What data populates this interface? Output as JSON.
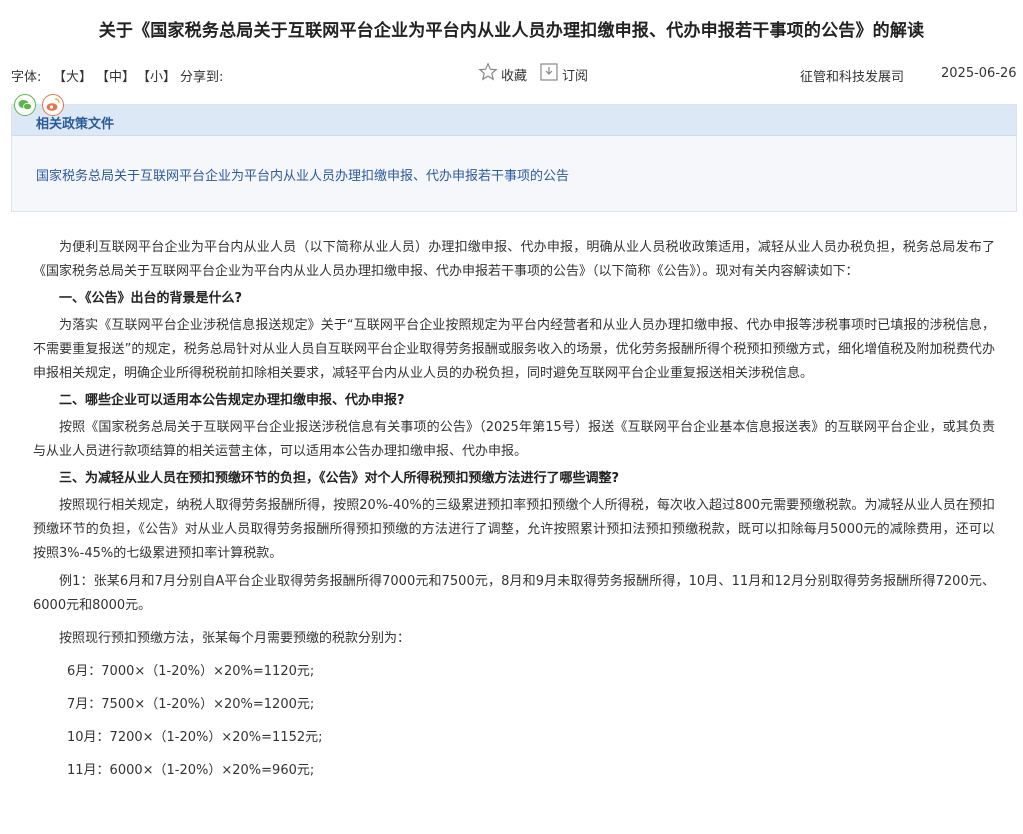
{
  "title": "关于《国家税务总局关于互联网平台企业为平台内从业人员办理扣缴申报、代办申报若干事项的公告》的解读",
  "toolbar": {
    "font_label": "字体:",
    "size_large": "【大】",
    "size_medium": "【中】",
    "size_small": "【小】",
    "share_label": "分享到:",
    "favorite_label": "收藏",
    "subscribe_label": "订阅",
    "department": "征管和科技发展司",
    "date": "2025-06-26"
  },
  "share_icons": {
    "wechat": "wechat-icon",
    "weibo": "weibo-icon"
  },
  "policy": {
    "heading": "相关政策文件",
    "link_text": "国家税务总局关于互联网平台企业为平台内从业人员办理扣缴申报、代办申报若干事项的公告"
  },
  "body": {
    "p1": "为便利互联网平台企业为平台内从业人员（以下简称从业人员）办理扣缴申报、代办申报，明确从业人员税收政策适用，减轻从业人员办税负担，税务总局发布了《国家税务总局关于互联网平台企业为平台内从业人员办理扣缴申报、代办申报若干事项的公告》（以下简称《公告》）。现对有关内容解读如下：",
    "h1": "一、《公告》出台的背景是什么?",
    "p2": "为落实《互联网平台企业涉税信息报送规定》关于“互联网平台企业按照规定为平台内经营者和从业人员办理扣缴申报、代办申报等涉税事项时已填报的涉税信息，不需要重复报送”的规定，税务总局针对从业人员自互联网平台企业取得劳务报酬或服务收入的场景，优化劳务报酬所得个税预扣预缴方式，细化增值税及附加税费代办申报相关规定，明确企业所得税税前扣除相关要求，减轻平台内从业人员的办税负担，同时避免互联网平台企业重复报送相关涉税信息。",
    "h2": "二、哪些企业可以适用本公告规定办理扣缴申报、代办申报?",
    "p3": "按照《国家税务总局关于互联网平台企业报送涉税信息有关事项的公告》（2025年第15号）报送《互联网平台企业基本信息报送表》的互联网平台企业，或其负责与从业人员进行款项结算的相关运营主体，可以适用本公告办理扣缴申报、代办申报。",
    "h3": "三、为减轻从业人员在预扣预缴环节的负担，《公告》对个人所得税预扣预缴方法进行了哪些调整?",
    "p4": "按照现行相关规定，纳税人取得劳务报酬所得，按照20%-40%的三级累进预扣率预扣预缴个人所得税，每次收入超过800元需要预缴税款。为减轻从业人员在预扣预缴环节的负担，《公告》对从业人员取得劳务报酬所得预扣预缴的方法进行了调整，允许按照累计预扣法预扣预缴税款，既可以扣除每月5000元的减除费用，还可以按照3%-45%的七级累进预扣率计算税款。",
    "p5": "例1：张某6月和7月分别自A平台企业取得劳务报酬所得7000元和7500元，8月和9月未取得劳务报酬所得，10月、11月和12月分别取得劳务报酬所得7200元、6000元和8000元。",
    "p6": "按照现行预扣预缴方法，张某每个月需要预缴的税款分别为：",
    "c1": "6月：7000×（1-20%）×20%=1120元;",
    "c2": "7月：7500×（1-20%）×20%=1200元;",
    "c3": "10月：7200×（1-20%）×20%=1152元;",
    "c4": "11月：6000×（1-20%）×20%=960元;"
  },
  "colors": {
    "accent": "#2b5aa0",
    "policy_head_bg": "#dde8f7",
    "policy_bg": "#f5f7fb"
  }
}
